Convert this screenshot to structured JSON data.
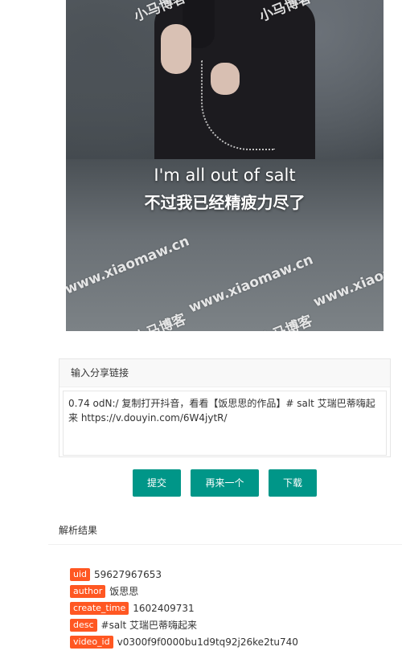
{
  "video": {
    "subtitle_en": "I'm all out of salt",
    "subtitle_cn": "不过我已经精疲力尽了",
    "watermarks": [
      "小马博客",
      "www.xiaomaw.cn",
      "www.xiaomaw.cn",
      "www.xiaomaw.cn",
      "小马博客",
      "小马博客",
      "小马博客"
    ]
  },
  "panel": {
    "header": "输入分享链接",
    "input_value": "0.74 odN:/ 复制打开抖音，看看【饭思思的作品】# salt 艾瑞巴蒂嗨起来 https://v.douyin.com/6W4jytR/"
  },
  "buttons": {
    "submit": "提交",
    "again": "再来一个",
    "download": "下载"
  },
  "results": {
    "title": "解析结果",
    "rows": [
      {
        "label": "uid",
        "value": "59627967653"
      },
      {
        "label": "author",
        "value": "饭思思"
      },
      {
        "label": "create_time",
        "value": "1602409731"
      },
      {
        "label": "desc",
        "value": "#salt 艾瑞巴蒂嗨起来"
      },
      {
        "label": "video_id",
        "value": "v0300f9f0000bu1d9tq92j26ke2tu740"
      }
    ]
  },
  "colors": {
    "button": "#009688",
    "tag": "#ff5722"
  }
}
